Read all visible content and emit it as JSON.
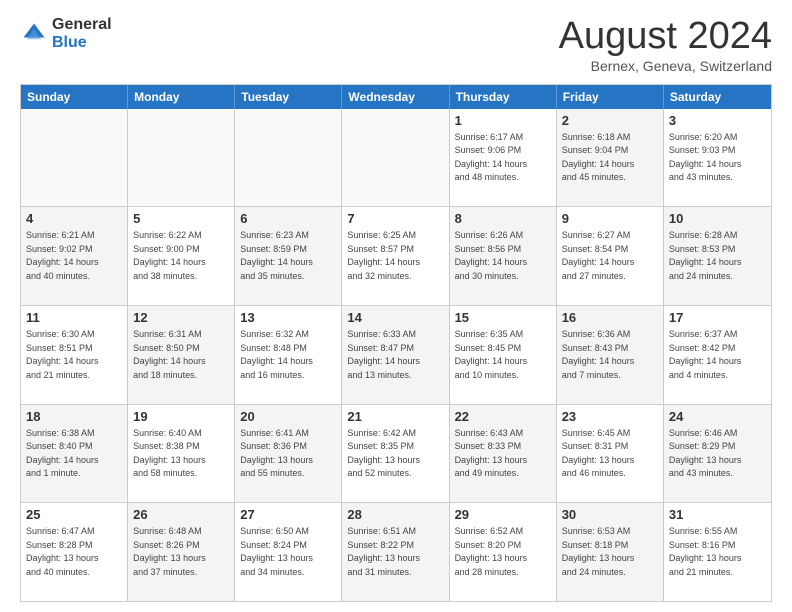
{
  "logo": {
    "general": "General",
    "blue": "Blue"
  },
  "title": "August 2024",
  "location": "Bernex, Geneva, Switzerland",
  "weekdays": [
    "Sunday",
    "Monday",
    "Tuesday",
    "Wednesday",
    "Thursday",
    "Friday",
    "Saturday"
  ],
  "weeks": [
    [
      {
        "day": "",
        "info": "",
        "empty": true
      },
      {
        "day": "",
        "info": "",
        "empty": true
      },
      {
        "day": "",
        "info": "",
        "empty": true
      },
      {
        "day": "",
        "info": "",
        "empty": true
      },
      {
        "day": "1",
        "info": "Sunrise: 6:17 AM\nSunset: 9:06 PM\nDaylight: 14 hours\nand 48 minutes."
      },
      {
        "day": "2",
        "info": "Sunrise: 6:18 AM\nSunset: 9:04 PM\nDaylight: 14 hours\nand 45 minutes.",
        "shaded": true
      },
      {
        "day": "3",
        "info": "Sunrise: 6:20 AM\nSunset: 9:03 PM\nDaylight: 14 hours\nand 43 minutes."
      }
    ],
    [
      {
        "day": "4",
        "info": "Sunrise: 6:21 AM\nSunset: 9:02 PM\nDaylight: 14 hours\nand 40 minutes.",
        "shaded": true
      },
      {
        "day": "5",
        "info": "Sunrise: 6:22 AM\nSunset: 9:00 PM\nDaylight: 14 hours\nand 38 minutes."
      },
      {
        "day": "6",
        "info": "Sunrise: 6:23 AM\nSunset: 8:59 PM\nDaylight: 14 hours\nand 35 minutes.",
        "shaded": true
      },
      {
        "day": "7",
        "info": "Sunrise: 6:25 AM\nSunset: 8:57 PM\nDaylight: 14 hours\nand 32 minutes."
      },
      {
        "day": "8",
        "info": "Sunrise: 6:26 AM\nSunset: 8:56 PM\nDaylight: 14 hours\nand 30 minutes.",
        "shaded": true
      },
      {
        "day": "9",
        "info": "Sunrise: 6:27 AM\nSunset: 8:54 PM\nDaylight: 14 hours\nand 27 minutes."
      },
      {
        "day": "10",
        "info": "Sunrise: 6:28 AM\nSunset: 8:53 PM\nDaylight: 14 hours\nand 24 minutes.",
        "shaded": true
      }
    ],
    [
      {
        "day": "11",
        "info": "Sunrise: 6:30 AM\nSunset: 8:51 PM\nDaylight: 14 hours\nand 21 minutes."
      },
      {
        "day": "12",
        "info": "Sunrise: 6:31 AM\nSunset: 8:50 PM\nDaylight: 14 hours\nand 18 minutes.",
        "shaded": true
      },
      {
        "day": "13",
        "info": "Sunrise: 6:32 AM\nSunset: 8:48 PM\nDaylight: 14 hours\nand 16 minutes."
      },
      {
        "day": "14",
        "info": "Sunrise: 6:33 AM\nSunset: 8:47 PM\nDaylight: 14 hours\nand 13 minutes.",
        "shaded": true
      },
      {
        "day": "15",
        "info": "Sunrise: 6:35 AM\nSunset: 8:45 PM\nDaylight: 14 hours\nand 10 minutes."
      },
      {
        "day": "16",
        "info": "Sunrise: 6:36 AM\nSunset: 8:43 PM\nDaylight: 14 hours\nand 7 minutes.",
        "shaded": true
      },
      {
        "day": "17",
        "info": "Sunrise: 6:37 AM\nSunset: 8:42 PM\nDaylight: 14 hours\nand 4 minutes."
      }
    ],
    [
      {
        "day": "18",
        "info": "Sunrise: 6:38 AM\nSunset: 8:40 PM\nDaylight: 14 hours\nand 1 minute.",
        "shaded": true
      },
      {
        "day": "19",
        "info": "Sunrise: 6:40 AM\nSunset: 8:38 PM\nDaylight: 13 hours\nand 58 minutes."
      },
      {
        "day": "20",
        "info": "Sunrise: 6:41 AM\nSunset: 8:36 PM\nDaylight: 13 hours\nand 55 minutes.",
        "shaded": true
      },
      {
        "day": "21",
        "info": "Sunrise: 6:42 AM\nSunset: 8:35 PM\nDaylight: 13 hours\nand 52 minutes."
      },
      {
        "day": "22",
        "info": "Sunrise: 6:43 AM\nSunset: 8:33 PM\nDaylight: 13 hours\nand 49 minutes.",
        "shaded": true
      },
      {
        "day": "23",
        "info": "Sunrise: 6:45 AM\nSunset: 8:31 PM\nDaylight: 13 hours\nand 46 minutes."
      },
      {
        "day": "24",
        "info": "Sunrise: 6:46 AM\nSunset: 8:29 PM\nDaylight: 13 hours\nand 43 minutes.",
        "shaded": true
      }
    ],
    [
      {
        "day": "25",
        "info": "Sunrise: 6:47 AM\nSunset: 8:28 PM\nDaylight: 13 hours\nand 40 minutes."
      },
      {
        "day": "26",
        "info": "Sunrise: 6:48 AM\nSunset: 8:26 PM\nDaylight: 13 hours\nand 37 minutes.",
        "shaded": true
      },
      {
        "day": "27",
        "info": "Sunrise: 6:50 AM\nSunset: 8:24 PM\nDaylight: 13 hours\nand 34 minutes."
      },
      {
        "day": "28",
        "info": "Sunrise: 6:51 AM\nSunset: 8:22 PM\nDaylight: 13 hours\nand 31 minutes.",
        "shaded": true
      },
      {
        "day": "29",
        "info": "Sunrise: 6:52 AM\nSunset: 8:20 PM\nDaylight: 13 hours\nand 28 minutes."
      },
      {
        "day": "30",
        "info": "Sunrise: 6:53 AM\nSunset: 8:18 PM\nDaylight: 13 hours\nand 24 minutes.",
        "shaded": true
      },
      {
        "day": "31",
        "info": "Sunrise: 6:55 AM\nSunset: 8:16 PM\nDaylight: 13 hours\nand 21 minutes."
      }
    ]
  ]
}
